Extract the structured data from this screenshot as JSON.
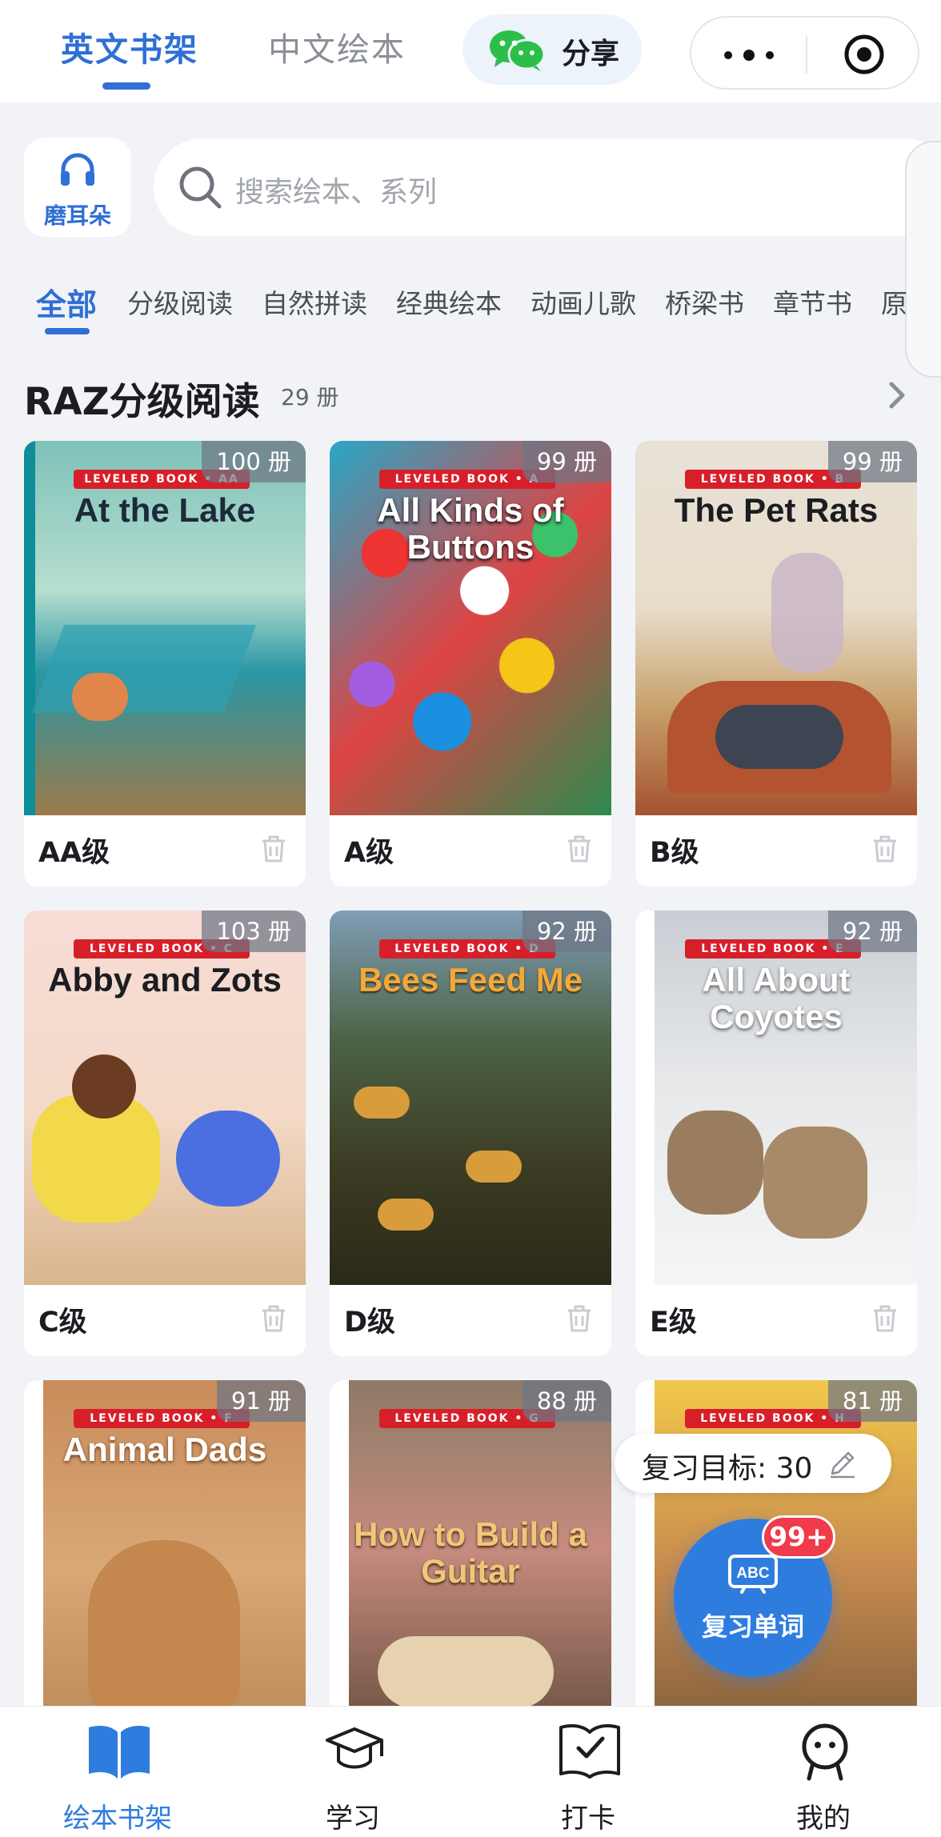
{
  "header": {
    "tabs": [
      "英文书架",
      "中文绘本"
    ],
    "share_label": "分享"
  },
  "search": {
    "ear_label": "磨耳朵",
    "placeholder": "搜索绘本、系列"
  },
  "categories": [
    "全部",
    "分级阅读",
    "自然拼读",
    "经典绘本",
    "动画儿歌",
    "桥梁书",
    "章节书",
    "原"
  ],
  "section": {
    "title": "RAZ分级阅读",
    "count": "29 册"
  },
  "books": [
    {
      "label": "AA级",
      "count": "100 册",
      "cover_title": "At the Lake",
      "band": "LEVELED BOOK • AA"
    },
    {
      "label": "A级",
      "count": "99 册",
      "cover_title": "All Kinds of Buttons",
      "band": "LEVELED BOOK • A"
    },
    {
      "label": "B级",
      "count": "99 册",
      "cover_title": "The Pet Rats",
      "band": "LEVELED BOOK • B"
    },
    {
      "label": "C级",
      "count": "103 册",
      "cover_title": "Abby and Zots",
      "band": "LEVELED BOOK • C"
    },
    {
      "label": "D级",
      "count": "92 册",
      "cover_title": "Bees Feed Me",
      "band": "LEVELED BOOK • D"
    },
    {
      "label": "E级",
      "count": "92 册",
      "cover_title": "All About Coyotes",
      "band": "LEVELED BOOK • E"
    },
    {
      "label": "",
      "count": "91 册",
      "cover_title": "Animal Dads",
      "band": "LEVELED BOOK • F"
    },
    {
      "label": "",
      "count": "88 册",
      "cover_title": "How to Build a Guitar",
      "band": "LEVELED BOOK • G"
    },
    {
      "label": "",
      "count": "81 册",
      "cover_title": "",
      "band": "LEVELED BOOK • H"
    }
  ],
  "floating": {
    "goal_text": "复习目标: 30",
    "review_label": "复习单词",
    "review_icon_text": "ABC",
    "badge": "99+"
  },
  "bottom_nav": [
    "绘本书架",
    "学习",
    "打卡",
    "我的"
  ],
  "colors": {
    "accent": "#2f6fd6",
    "badge_red": "#ef3b4b",
    "review_blue": "#2f7cdf"
  }
}
